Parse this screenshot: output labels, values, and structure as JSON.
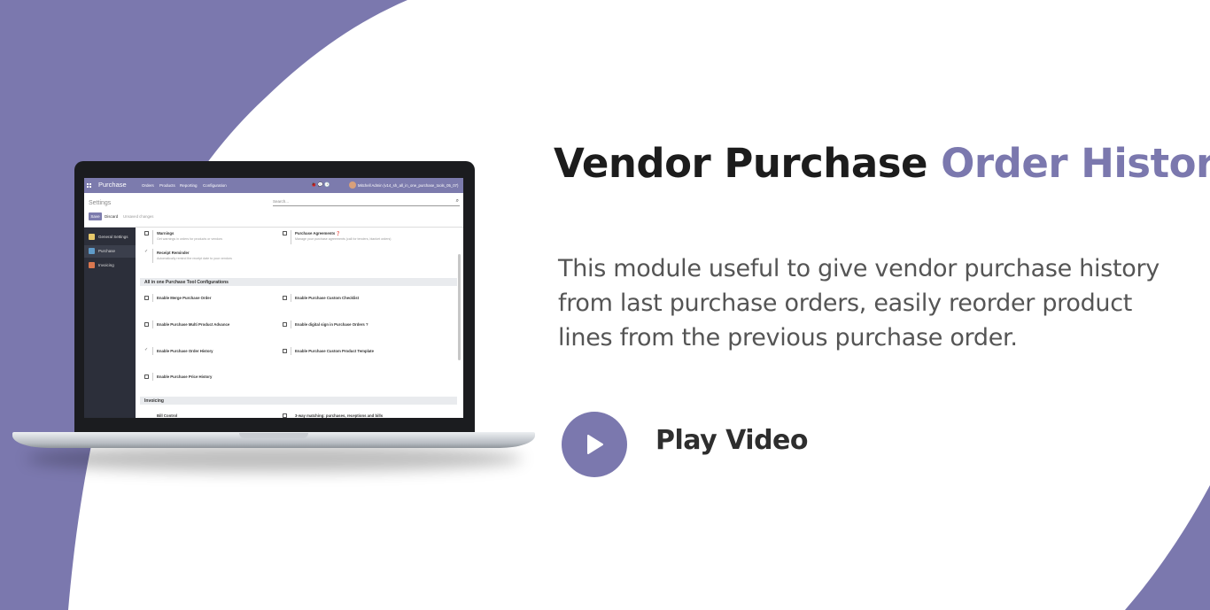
{
  "colors": {
    "accent": "#7b78ae",
    "background": "#ffffff",
    "headline_dark": "#1c1c1c",
    "body_text": "#555555",
    "odoo_navbar": "#7c7bad",
    "odoo_sidebar": "#2c2f3a"
  },
  "hero": {
    "title_part1": "Vendor Purchase",
    "title_part2": "Order History",
    "description": "This module useful to give vendor purchase history from last purchase orders, easily reorder product lines from the previous purchase order.",
    "play_icon": "play-icon",
    "play_label": "Play Video"
  },
  "screen": {
    "app_name": "Purchase",
    "menu": [
      "Orders",
      "Products",
      "Reporting",
      "Configuration"
    ],
    "user": "Mitchell Admin (v14_sh_all_in_one_purchase_tools_05_07)",
    "breadcrumb": "Settings",
    "search_placeholder": "Search...",
    "save_label": "Save",
    "discard_label": "Discard",
    "unsaved_label": "Unsaved changes",
    "sidebar": [
      "General Settings",
      "Purchase",
      "Invoicing"
    ],
    "top_settings": {
      "warnings_title": "Warnings",
      "warnings_desc": "Get warnings in orders for products or vendors",
      "agreements_title": "Purchase Agreements",
      "agreements_desc": "Manage your purchase agreements (call for tenders, blanket orders)",
      "receipt_title": "Receipt Reminder",
      "receipt_desc": "Automatically remind the receipt date to your vendors"
    },
    "section_title": "All in one Purchase Tool Configurations",
    "options": [
      {
        "label": "Enable Merge Purchase Order",
        "checked": false
      },
      {
        "label": "Enable Purchase Custom Checklist",
        "checked": false
      },
      {
        "label": "Enable Purchase Multi Product Advance",
        "checked": false
      },
      {
        "label": "Enable digital sign in Purchase Orders ?",
        "checked": false
      },
      {
        "label": "Enable Purchase Order History",
        "checked": true
      },
      {
        "label": "Enable Purchase Custom Product Template",
        "checked": false
      },
      {
        "label": "Enable Purchase Price History",
        "checked": false
      }
    ],
    "invoicing_title": "Invoicing",
    "bill_control": "Bill Control",
    "three_way": "3-way matching: purchases, receptions and bills"
  }
}
